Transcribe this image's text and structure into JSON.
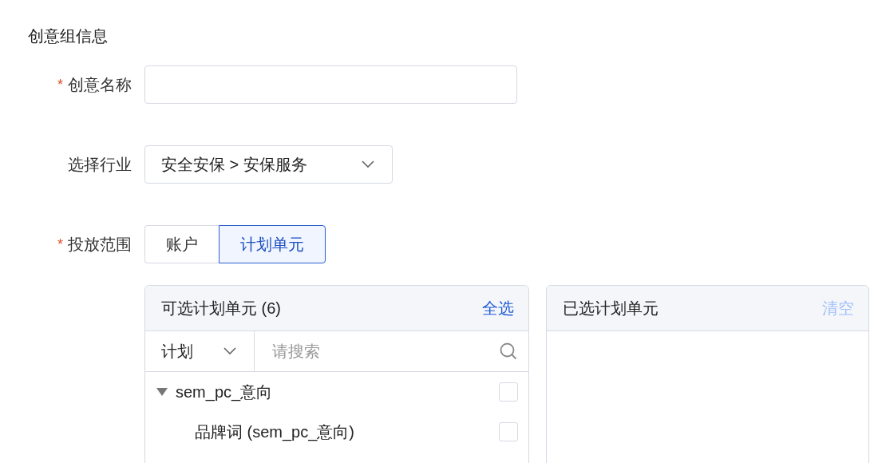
{
  "section_title": "创意组信息",
  "fields": [
    {
      "kind": "input",
      "label": "创意名称",
      "required_mark": "*"
    },
    {
      "kind": "select",
      "label": "选择行业",
      "value": "安全安保 > 安保服务"
    },
    {
      "kind": "segmented",
      "label": "投放范围",
      "required_mark": "*",
      "options": [
        {
          "label": "账户",
          "selected": false
        },
        {
          "label": "计划单元",
          "selected": true
        }
      ]
    }
  ],
  "available": {
    "title": "可选计划单元",
    "count": "(6)",
    "select_all": "全选",
    "filter": "计划",
    "search_placeholder": "请搜索",
    "tree": [
      {
        "label": "sem_pc_意向",
        "expanded": true,
        "checked": false,
        "children": [
          {
            "label": "品牌词 (sem_pc_意向)",
            "checked": false
          }
        ]
      }
    ]
  },
  "selected_panel": {
    "title": "已选计划单元",
    "clear": "清空",
    "clear_disabled": true
  }
}
